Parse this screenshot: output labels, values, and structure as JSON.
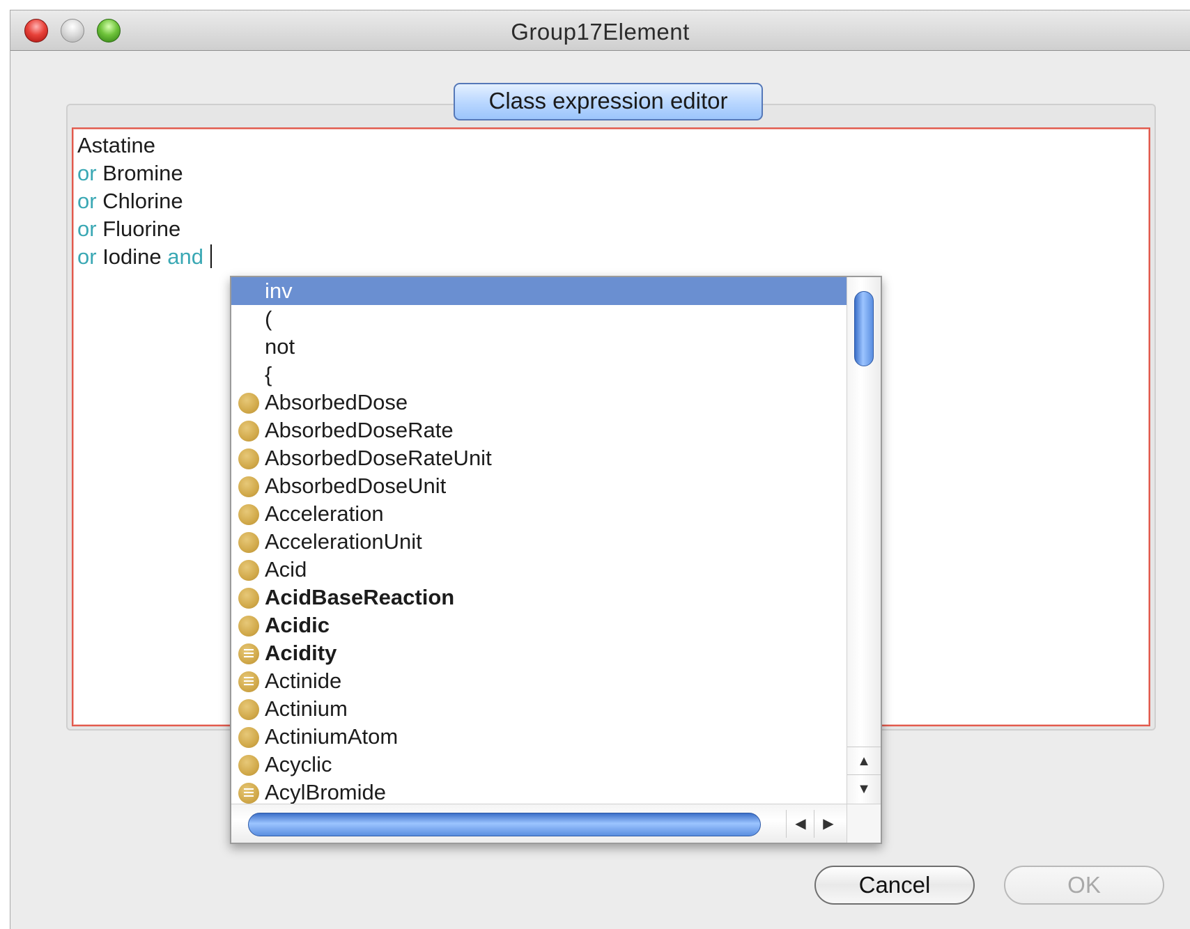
{
  "window": {
    "title": "Group17Element"
  },
  "group": {
    "label": "Class expression editor"
  },
  "editor": {
    "lines": [
      [
        {
          "text": "Astatine",
          "kw": false
        }
      ],
      [
        {
          "text": "or",
          "kw": true
        },
        {
          "text": " Bromine",
          "kw": false
        }
      ],
      [
        {
          "text": "or",
          "kw": true
        },
        {
          "text": " Chlorine",
          "kw": false
        }
      ],
      [
        {
          "text": "or",
          "kw": true
        },
        {
          "text": " Fluorine",
          "kw": false
        }
      ],
      [
        {
          "text": "or",
          "kw": true
        },
        {
          "text": " Iodine ",
          "kw": false
        },
        {
          "text": "and",
          "kw": true
        }
      ]
    ]
  },
  "autocomplete": {
    "items": [
      {
        "label": "inv",
        "icon": "none",
        "bold": false,
        "selected": true
      },
      {
        "label": "(",
        "icon": "none",
        "bold": false,
        "selected": false
      },
      {
        "label": "not",
        "icon": "none",
        "bold": false,
        "selected": false
      },
      {
        "label": "{",
        "icon": "none",
        "bold": false,
        "selected": false
      },
      {
        "label": "AbsorbedDose",
        "icon": "class-icon",
        "bold": false,
        "selected": false
      },
      {
        "label": "AbsorbedDoseRate",
        "icon": "class-icon",
        "bold": false,
        "selected": false
      },
      {
        "label": "AbsorbedDoseRateUnit",
        "icon": "class-icon",
        "bold": false,
        "selected": false
      },
      {
        "label": "AbsorbedDoseUnit",
        "icon": "class-icon",
        "bold": false,
        "selected": false
      },
      {
        "label": "Acceleration",
        "icon": "class-icon",
        "bold": false,
        "selected": false
      },
      {
        "label": "AccelerationUnit",
        "icon": "class-icon",
        "bold": false,
        "selected": false
      },
      {
        "label": "Acid",
        "icon": "class-icon",
        "bold": false,
        "selected": false
      },
      {
        "label": "AcidBaseReaction",
        "icon": "class-icon",
        "bold": true,
        "selected": false
      },
      {
        "label": "Acidic",
        "icon": "class-icon",
        "bold": true,
        "selected": false
      },
      {
        "label": "Acidity",
        "icon": "defined-class-icon",
        "bold": true,
        "selected": false
      },
      {
        "label": "Actinide",
        "icon": "defined-class-icon",
        "bold": false,
        "selected": false
      },
      {
        "label": "Actinium",
        "icon": "class-icon",
        "bold": false,
        "selected": false
      },
      {
        "label": "ActiniumAtom",
        "icon": "class-icon",
        "bold": false,
        "selected": false
      },
      {
        "label": "Acyclic",
        "icon": "class-icon",
        "bold": false,
        "selected": false
      },
      {
        "label": "AcylBromide",
        "icon": "defined-class-icon",
        "bold": false,
        "selected": false
      }
    ],
    "scroll_up_icon": "arrow-up-icon",
    "scroll_down_icon": "arrow-down-icon",
    "scroll_left_icon": "arrow-left-icon",
    "scroll_right_icon": "arrow-right-icon"
  },
  "buttons": {
    "cancel": "Cancel",
    "ok": "OK"
  }
}
